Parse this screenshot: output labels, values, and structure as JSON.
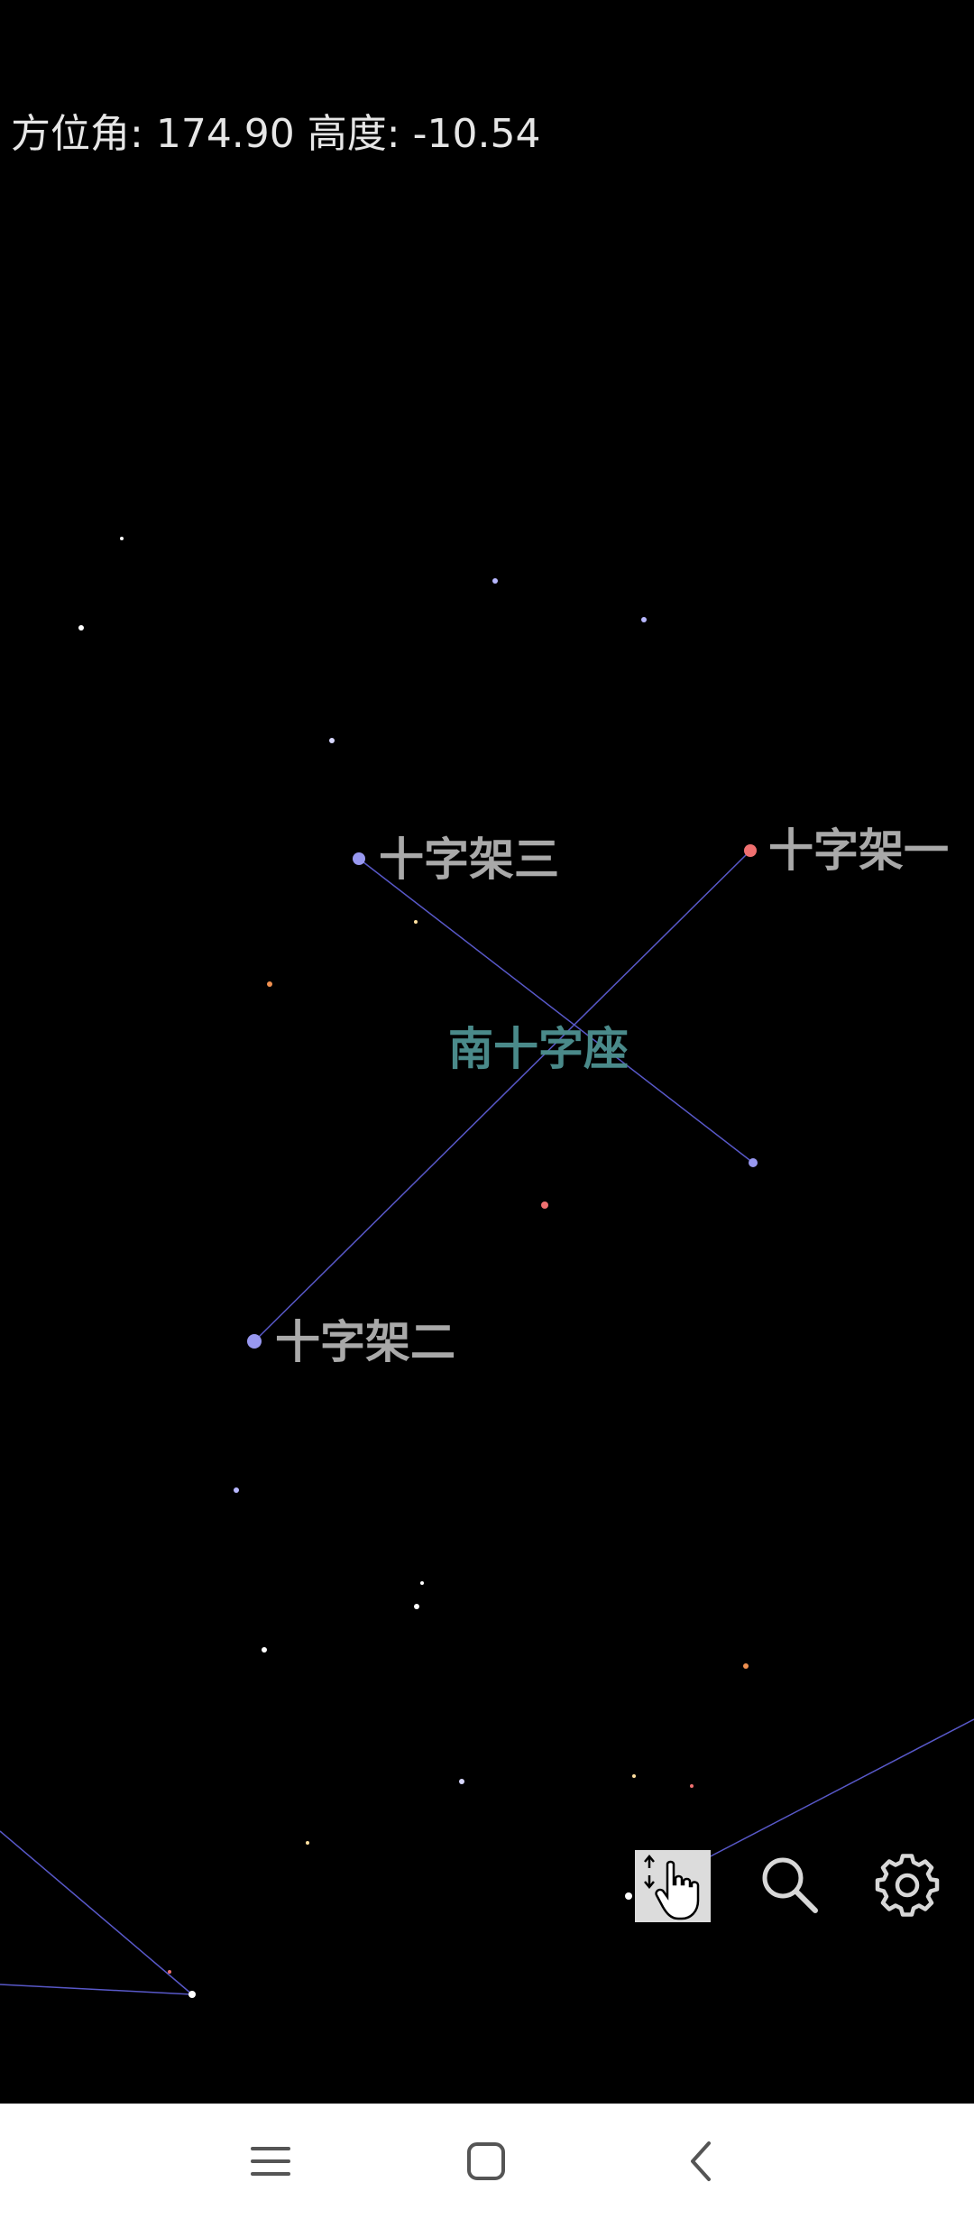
{
  "readout": {
    "azimuth_label": "方位角:",
    "azimuth_value": "174.90",
    "altitude_label": "高度:",
    "altitude_value": "-10.54"
  },
  "constellation": {
    "name": "南十字座",
    "label_color": "#4a8a8a",
    "line_color": "#5858c8"
  },
  "stars": {
    "alpha": {
      "label": "十字架一",
      "color": "#f07070"
    },
    "beta": {
      "label": "十字架三",
      "color": "#9898f0"
    },
    "gamma": {
      "label": "十字架二",
      "color": "#9898f0"
    }
  },
  "toolbar": {
    "mode_icon": "drag-pointer-icon",
    "search_icon": "search-icon",
    "settings_icon": "gear-icon"
  },
  "navbar": {
    "menu_icon": "menu-icon",
    "home_icon": "home-square-icon",
    "back_icon": "back-chevron-icon"
  }
}
